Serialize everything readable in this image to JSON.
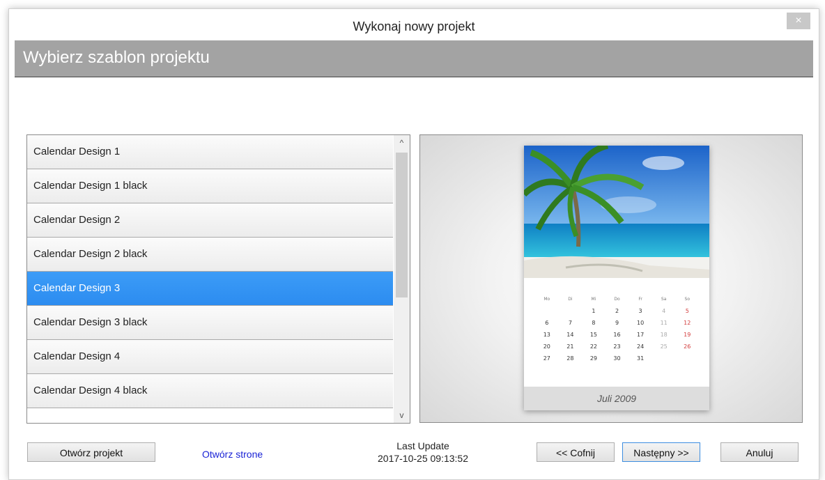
{
  "window": {
    "title": "Wykonaj nowy projekt",
    "close_glyph": "×"
  },
  "banner": {
    "title": "Wybierz szablon projektu"
  },
  "template_list": {
    "items": [
      "Calendar Design 1",
      "Calendar Design 1 black",
      "Calendar Design 2",
      "Calendar Design 2 black",
      "Calendar Design 3",
      "Calendar Design 3 black",
      "Calendar Design 4",
      "Calendar Design 4 black"
    ],
    "selected_index": 4,
    "scroll_up_glyph": "^",
    "scroll_down_glyph": "v"
  },
  "preview": {
    "weekdays": [
      "Mo",
      "Di",
      "Mi",
      "Do",
      "Fr",
      "Sa",
      "So"
    ],
    "weeks": [
      [
        "",
        "",
        "1",
        "2",
        "3",
        "4",
        "5"
      ],
      [
        "6",
        "7",
        "8",
        "9",
        "10",
        "11",
        "12"
      ],
      [
        "13",
        "14",
        "15",
        "16",
        "17",
        "18",
        "19"
      ],
      [
        "20",
        "21",
        "22",
        "23",
        "24",
        "25",
        "26"
      ],
      [
        "27",
        "28",
        "29",
        "30",
        "31",
        "",
        ""
      ]
    ],
    "month_label": "Juli 2009"
  },
  "footer": {
    "open_project_label": "Otwórz projekt",
    "open_page_link": "Otwórz strone",
    "last_update_label": "Last Update",
    "last_update_value": "2017-10-25 09:13:52",
    "back_label": "<< Cofnij",
    "next_label": "Następny  >>",
    "cancel_label": "Anuluj"
  },
  "colors": {
    "selection": "#2c8cf0",
    "banner": "#a3a3a3",
    "link": "#1a23d6",
    "weekend_red": "#d23a3a"
  }
}
